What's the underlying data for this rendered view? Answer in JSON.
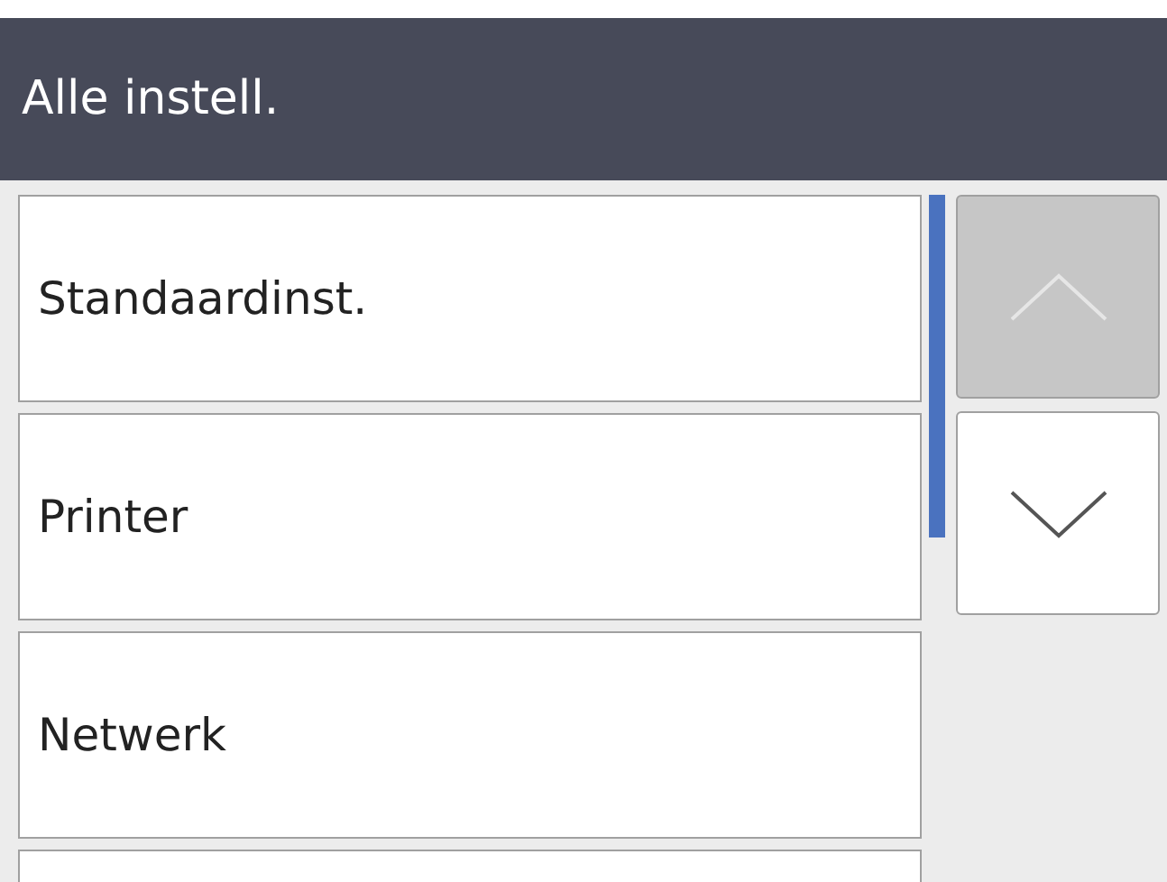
{
  "header": {
    "title": "Alle instell."
  },
  "items": [
    {
      "kind": "text",
      "label": "Standaardinst."
    },
    {
      "kind": "text",
      "label": "Printer"
    },
    {
      "kind": "text",
      "label": "Netwerk"
    },
    {
      "kind": "blank"
    }
  ],
  "scroll_buttons": [
    {
      "kind": "up",
      "disabled": true
    },
    {
      "kind": "down",
      "disabled": false
    }
  ]
}
